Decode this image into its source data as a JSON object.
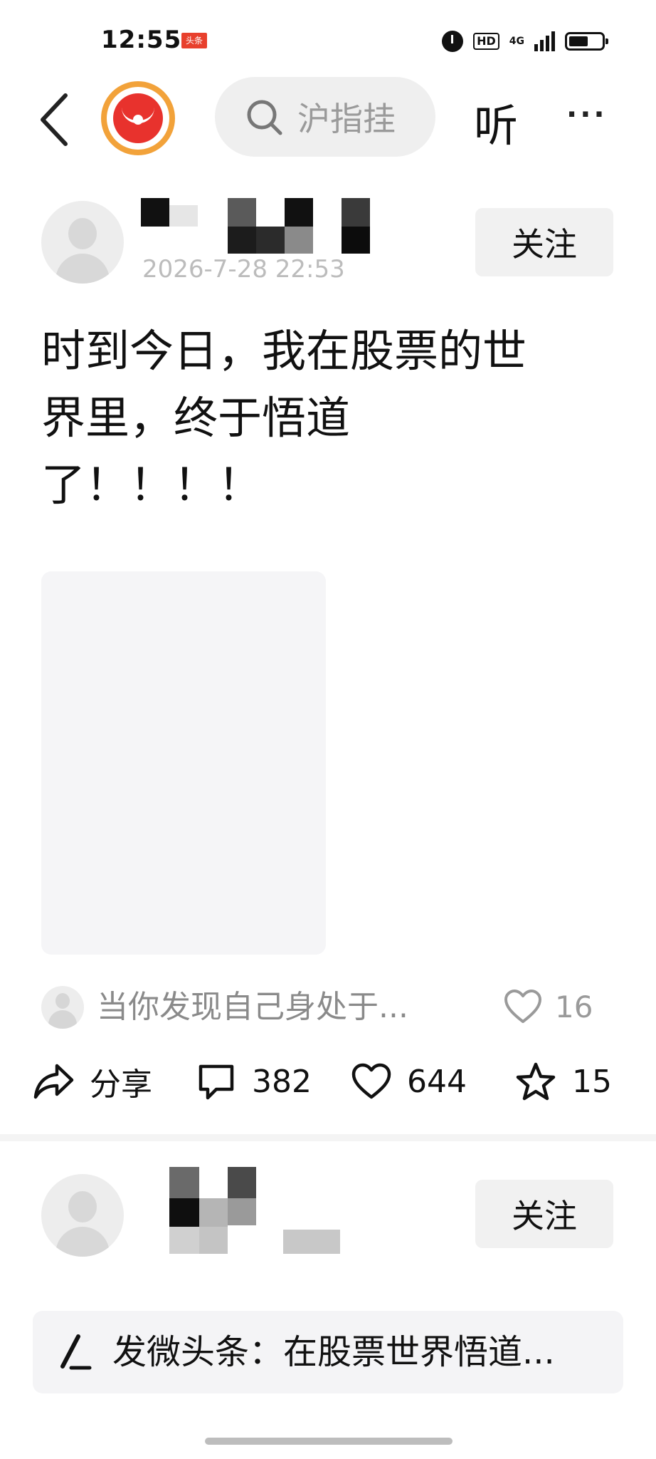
{
  "status_bar": {
    "time": "12:55",
    "app_badge": "头条",
    "hd_label": "HD",
    "network_label": "4G",
    "icons": [
      "alarm-icon",
      "hd-icon",
      "signal-icon",
      "battery-icon"
    ]
  },
  "nav": {
    "back_icon": "chevron-left-icon",
    "logo_icon": "red-packet-logo-icon",
    "search_placeholder": "沪指挂",
    "listen_label": "听",
    "more_label": "···"
  },
  "post": {
    "date": "2026-7-28 22:53",
    "follow_label": "关注",
    "text": "时到今日，我在股票的世\n界里，终于悟道\n了！！！！"
  },
  "top_comment": {
    "text": "当你发现自己身处于...",
    "like_count": "16"
  },
  "actions": {
    "share_label": "分享",
    "comment_count": "382",
    "like_count": "644",
    "favorite_count": "15"
  },
  "second_user": {
    "follow_label": "关注"
  },
  "compose": {
    "text": "发微头条：在股票世界悟道..."
  },
  "colors": {
    "accent_red": "#e8322d",
    "logo_ring": "#f2a23a",
    "muted_text": "#9a9a9a"
  }
}
